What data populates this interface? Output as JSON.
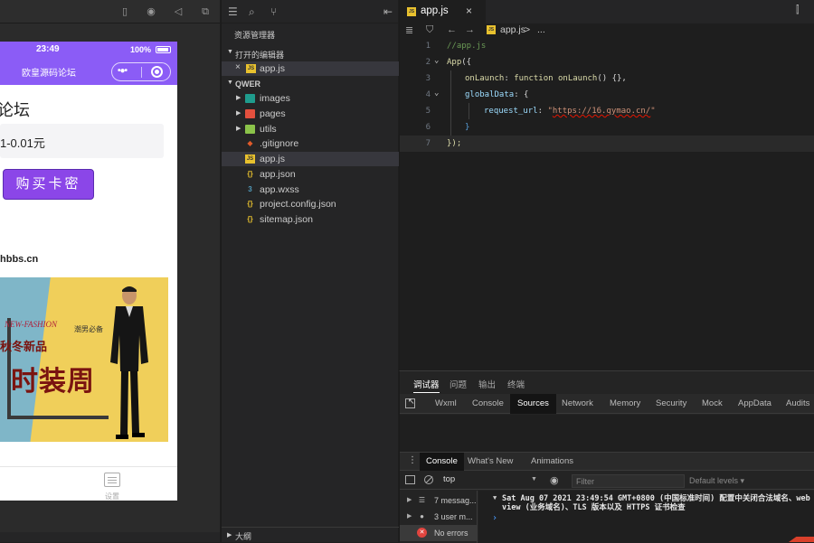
{
  "simulator": {
    "status_time": "23:49",
    "battery": "100%",
    "nav_title": "欧皇源码论坛",
    "heading": "论坛",
    "price": "1-0.01元",
    "buy_button": "购买卡密",
    "site_url": "hbbs.cn",
    "banner": {
      "fashion_text": "NEW-FASHION",
      "tag": "潮男必备",
      "line1": "秋冬新品",
      "main": "时装周"
    },
    "tab_label": "设置"
  },
  "explorer": {
    "title": "资源管理器",
    "open_editors_label": "打开的编辑器",
    "open_editors": [
      {
        "name": "app.js",
        "icon": "js-file-icon"
      }
    ],
    "project_name": "QWER",
    "folders": [
      {
        "name": "images",
        "color": "#1f9c8d"
      },
      {
        "name": "pages",
        "color": "#e3503e"
      },
      {
        "name": "utils",
        "color": "#8bc34a"
      }
    ],
    "files": [
      {
        "name": ".gitignore",
        "icon": "git-icon"
      },
      {
        "name": "app.js",
        "icon": "js-file-icon"
      },
      {
        "name": "app.json",
        "icon": "json-file-icon"
      },
      {
        "name": "app.wxss",
        "icon": "css-file-icon"
      },
      {
        "name": "project.config.json",
        "icon": "json-file-icon"
      },
      {
        "name": "sitemap.json",
        "icon": "json-file-icon"
      }
    ],
    "outline_label": "大纲"
  },
  "editor": {
    "tab_name": "app.js",
    "breadcrumb_file": "app.js",
    "breadcrumb_sep": ">",
    "breadcrumb_more": "...",
    "line_numbers": [
      "1",
      "2",
      "3",
      "4",
      "5",
      "6",
      "7"
    ],
    "code": {
      "comment": "//app.js",
      "app_call": "App",
      "app_open": "({",
      "onlaunch_key": "onLaunch",
      "colon": ": ",
      "function_kw": "function",
      "onlaunch_name": "onLaunch",
      "onlaunch_rest": "() {},",
      "globaldata_key": "globalData",
      "globaldata_rest": ": {",
      "request_key": "request_url",
      "request_colon": ": ",
      "quote": "\"",
      "url": "https://16.qymao.cn/",
      "close_brace": "}",
      "close_all": "});"
    }
  },
  "debugger": {
    "panel_tabs": [
      "调试器",
      "问题",
      "输出",
      "终端"
    ],
    "dev_tabs": [
      "Wxml",
      "Console",
      "Sources",
      "Network",
      "Memory",
      "Security",
      "Mock",
      "AppData",
      "Audits"
    ],
    "drawer_tabs": [
      "Console",
      "What's New",
      "Animations"
    ],
    "context": "top",
    "filter_placeholder": "Filter",
    "levels": "Default levels ▾",
    "sidebar": [
      {
        "label": "7 messag...",
        "icon": "list-icon"
      },
      {
        "label": "3 user m...",
        "icon": "user-icon"
      },
      {
        "label": "No errors",
        "icon": "error-icon"
      }
    ],
    "log_line1": "Sat Aug 07 2021 23:49:54 GMT+0800 (中国标准时间) 配置中关闭合法域名、web",
    "log_line2": "view (业务域名)、TLS 版本以及 HTTPS 证书检查",
    "prompt": "›"
  }
}
